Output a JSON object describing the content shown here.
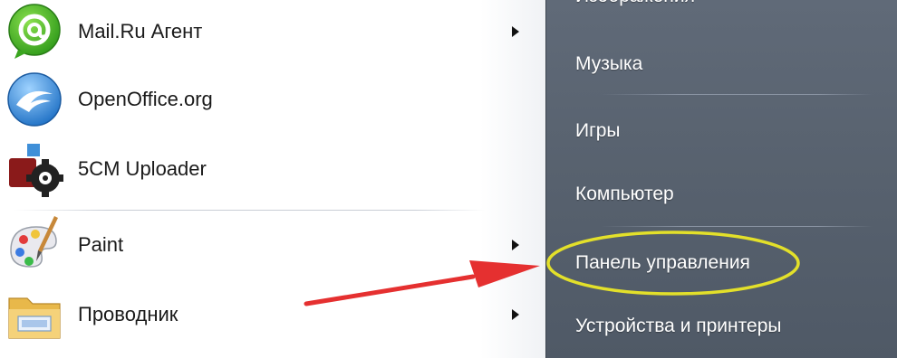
{
  "start_menu": {
    "programs": [
      {
        "label": "Mail.Ru Агент",
        "icon": "mailru-agent-icon",
        "has_submenu": true
      },
      {
        "label": "OpenOffice.org",
        "icon": "openoffice-icon",
        "has_submenu": false
      },
      {
        "label": "5CM Uploader",
        "icon": "uploader-icon",
        "has_submenu": false
      },
      {
        "label": "Paint",
        "icon": "paint-palette-icon",
        "has_submenu": true
      },
      {
        "label": "Проводник",
        "icon": "explorer-folder-icon",
        "has_submenu": true
      }
    ],
    "places": [
      {
        "label": "Изображения"
      },
      {
        "label": "Музыка"
      },
      {
        "label": "Игры"
      },
      {
        "label": "Компьютер"
      },
      {
        "label": "Панель управления"
      },
      {
        "label": "Устройства и принтеры"
      }
    ]
  },
  "annotation": {
    "highlight_color": "#e3e02a",
    "arrow_color": "#e53030"
  },
  "colors": {
    "right_pane": "#58626f",
    "left_pane": "#ffffff"
  }
}
